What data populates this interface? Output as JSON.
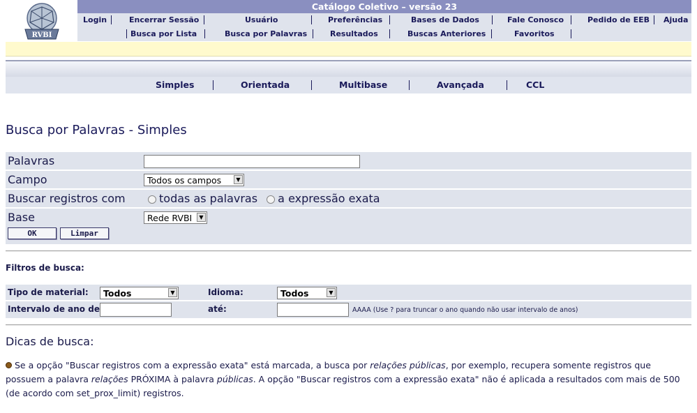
{
  "header": {
    "title": "Catálogo Coletivo – versão 23",
    "logo_text": "RVBI"
  },
  "menu_row1": [
    "Login",
    "Encerrar Sessão",
    "Usuário",
    "Preferências",
    "Bases de Dados",
    "Fale Conosco",
    "Pedido de EEB",
    "Ajuda"
  ],
  "menu_row2": [
    "Busca por Lista",
    "Busca por Palavras",
    "Resultados",
    "Buscas Anteriores",
    "Favoritos"
  ],
  "tabs": [
    "Simples",
    "Orientada",
    "Multibase",
    "Avançada",
    "CCL"
  ],
  "page_title": "Busca por Palavras - Simples",
  "form": {
    "palavras_label": "Palavras",
    "palavras_value": "",
    "campo_label": "Campo",
    "campo_value": "Todos os campos",
    "buscar_label": "Buscar registros com",
    "radio1_label": "todas as palavras",
    "radio2_label": "a expressão exata",
    "base_label": "Base",
    "base_value": "Rede RVBI",
    "ok_label": "OK",
    "limpar_label": "Limpar"
  },
  "filters": {
    "heading": "Filtros de busca:",
    "tipo_label": "Tipo de material:",
    "tipo_value": "Todos",
    "idioma_label": "Idioma:",
    "idioma_value": "Todos",
    "ano_de_label": "Intervalo de ano de:",
    "ano_de_value": "",
    "ate_label": "até:",
    "ate_value": "",
    "ano_hint": "AAAA (Use ? para truncar o ano quando não usar intervalo de anos)"
  },
  "tips": {
    "heading": "Dicas de busca:",
    "t1": "Se a opção \"Buscar registros com a expressão exata\" está marcada, a busca por ",
    "t2": "relações públicas",
    "t3": ", por exemplo, recupera somente registros que possuem a palavra ",
    "t4": "relações",
    "t5": " PRÓXIMA à palavra ",
    "t6": "públicas",
    "t7": ". A opção \"Buscar registros com a expressão exata\" não é aplicada a resultados com mais de 500 (de acordo com set_prox_limit) registros."
  }
}
